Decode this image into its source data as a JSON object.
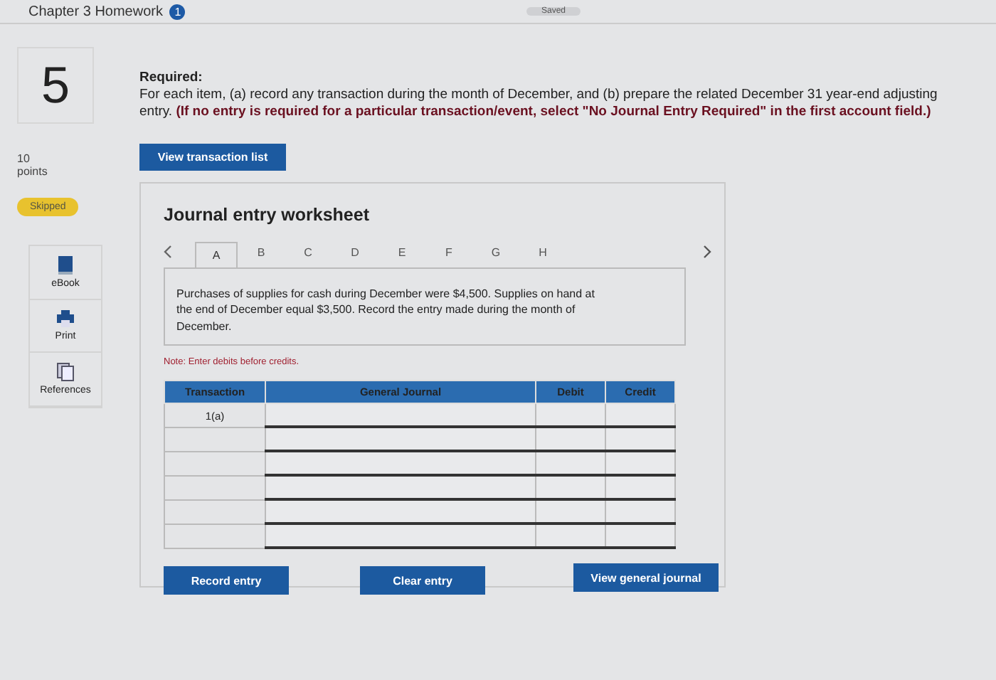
{
  "header": {
    "title": "Chapter 3 Homework",
    "badge": "1",
    "status": "Saved"
  },
  "question": {
    "number": "5",
    "points": "10",
    "points_label": "points",
    "status": "Skipped",
    "heading": "Required:",
    "instruction": "For each item, (a) record any transaction during the month of December, and (b) prepare the related December 31 year-end adjusting entry. **(If no entry is required for a particular transaction/event, select \"No Journal Entry Required\" in the first account field.)**"
  },
  "resources": [
    {
      "kind": "ebook",
      "label": "eBook"
    },
    {
      "kind": "print",
      "label": "Print"
    },
    {
      "kind": "references",
      "label": "References"
    }
  ],
  "view_transaction_button": "View transaction list",
  "worksheet": {
    "title": "Journal entry worksheet",
    "tabs": [
      {
        "label": "A",
        "selected": true
      },
      {
        "label": "B",
        "selected": false
      },
      {
        "label": "C",
        "selected": false
      },
      {
        "label": "D",
        "selected": false
      },
      {
        "label": "E",
        "selected": false
      },
      {
        "label": "F",
        "selected": false
      },
      {
        "label": "G",
        "selected": false
      },
      {
        "label": "H",
        "selected": false
      }
    ],
    "description": "Purchases of supplies for cash during December were $4,500. Supplies on hand at the end of December equal $3,500. Record the entry made during the month of December.",
    "note": "Note: Enter debits before credits.",
    "columns": [
      "Transaction",
      "General Journal",
      "Debit",
      "Credit"
    ],
    "rows": [
      {
        "transaction": "1(a)"
      },
      {},
      {},
      {},
      {},
      {}
    ],
    "buttons": [
      "Record entry",
      "Clear entry",
      "View general journal"
    ]
  }
}
